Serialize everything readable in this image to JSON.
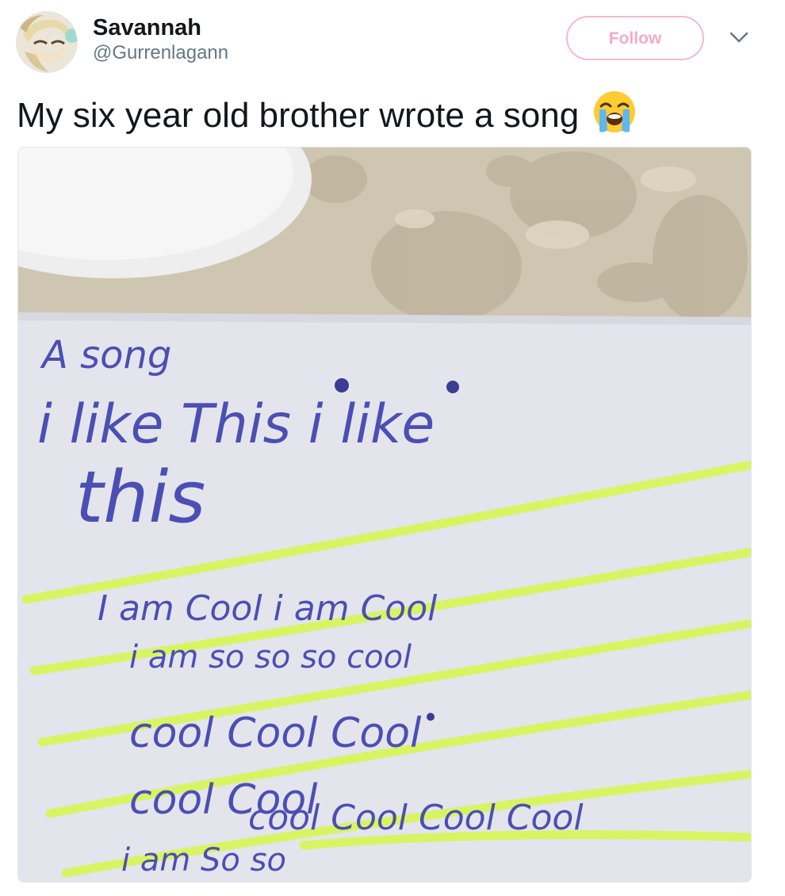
{
  "user": {
    "display_name": "Savannah",
    "handle": "@Gurrenlagann",
    "avatar": "anime-character-avatar"
  },
  "actions": {
    "follow_label": "Follow",
    "more_icon": "chevron-down-icon"
  },
  "tweet": {
    "text": "My six year old brother wrote a song",
    "emoji": "loudly-crying-face-emoji"
  },
  "photo": {
    "handwriting": {
      "title": "A song",
      "line1": "i like This i like",
      "line2": "this",
      "line3": "I am Cool i am Cool",
      "line4": "i am so so so cool",
      "line5": "cool Cool Cool",
      "line6": "cool Cool",
      "line7": "cool Cool Cool Cool",
      "line8": "i am So so"
    },
    "colors": {
      "tablecloth": "#cfc6b2",
      "paper": "#e4e4ec",
      "ink": "#4b4fb3",
      "highlighter": "#d8f55c"
    }
  },
  "colors": {
    "follow_accent": "#f5abc4",
    "handle": "#657786",
    "text": "#14171a"
  }
}
